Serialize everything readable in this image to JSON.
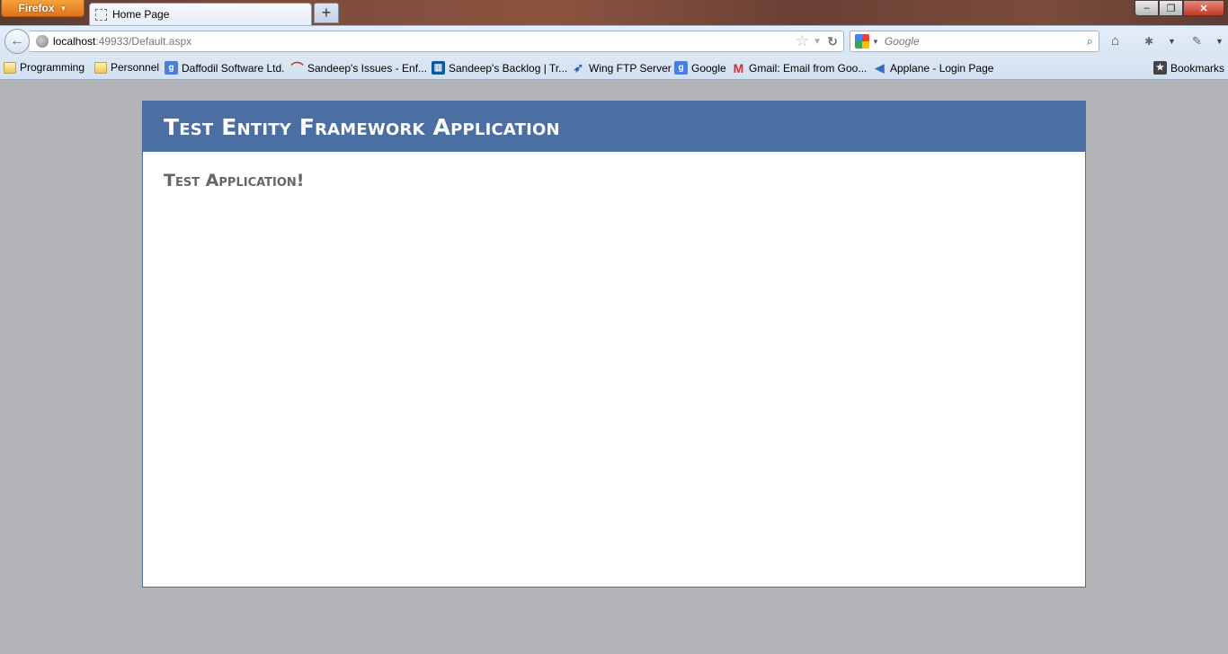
{
  "browser": {
    "menu_button_label": "Firefox",
    "tab_title": "Home Page",
    "new_tab_label": "+",
    "window_controls": {
      "minimize": "–",
      "restore": "❐",
      "close": "✕"
    }
  },
  "navigation": {
    "url_host": "localhost",
    "url_rest": ":49933/Default.aspx",
    "search_placeholder": "Google"
  },
  "bookmarks": [
    {
      "label": "Programming",
      "icon": "folder-icon"
    },
    {
      "label": "Personnel",
      "icon": "folder-icon"
    },
    {
      "label": "Daffodil Software Ltd.",
      "icon": "google-icon"
    },
    {
      "label": "Sandeep's Issues - Enf...",
      "icon": "issues-icon"
    },
    {
      "label": "Sandeep's Backlog | Tr...",
      "icon": "trello-icon"
    },
    {
      "label": "Wing FTP Server",
      "icon": "wing-icon"
    },
    {
      "label": "Google",
      "icon": "google-icon"
    },
    {
      "label": "Gmail: Email from Goo...",
      "icon": "gmail-icon"
    },
    {
      "label": "Applane - Login Page",
      "icon": "applane-icon"
    }
  ],
  "bookmarks_menu_label": "Bookmarks",
  "page": {
    "header_title": "Test Entity Framework Application",
    "subtitle": "Test Application!",
    "header_color": "#4b6ea3"
  }
}
